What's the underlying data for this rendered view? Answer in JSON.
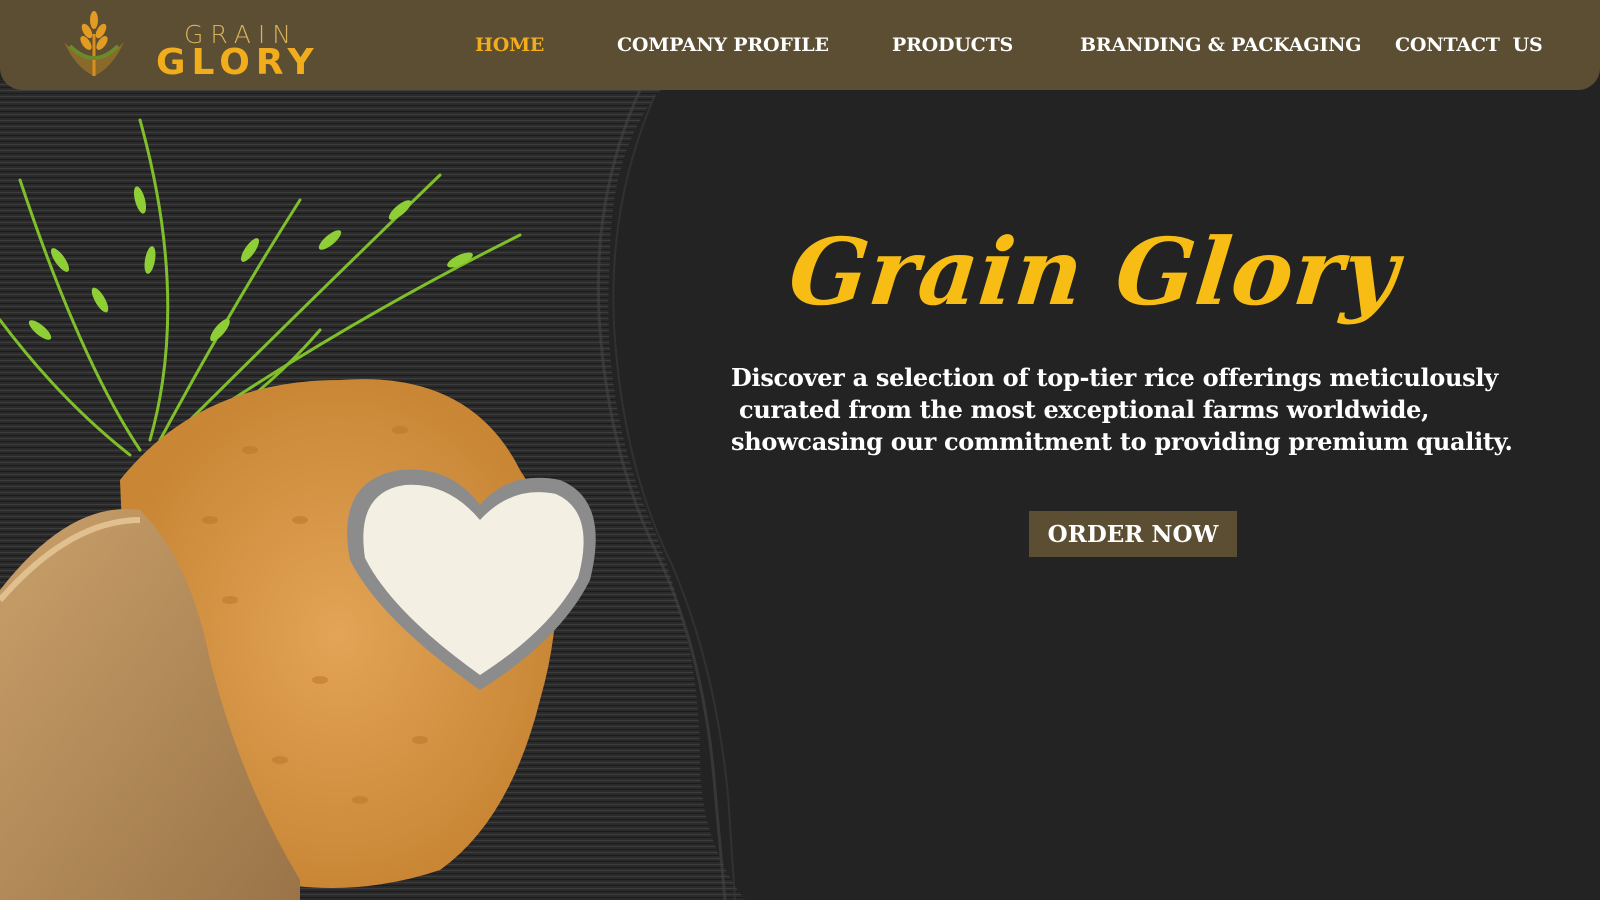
{
  "brand": {
    "name_top": "GRAIN",
    "name_bottom": "GLORY",
    "logo_icon": "wheat-sprout-icon",
    "colors": {
      "gold": "#f2ad1c",
      "bar": "#5b4e33",
      "background": "#232323"
    }
  },
  "nav": {
    "items": [
      {
        "label": "HOME",
        "active": true
      },
      {
        "label": "COMPANY PROFILE",
        "active": false
      },
      {
        "label": "PRODUCTS",
        "active": false
      },
      {
        "label": "BRANDING & PACKAGING",
        "active": false
      },
      {
        "label": "CONTACT  US",
        "active": false
      }
    ]
  },
  "hero": {
    "title": "Grain Glory",
    "description_lines": [
      "Discover a selection of top-tier rice offerings meticulously",
      " curated from the most exceptional farms worldwide,",
      "showcasing our commitment to providing premium quality."
    ],
    "cta_label": "ORDER NOW"
  }
}
